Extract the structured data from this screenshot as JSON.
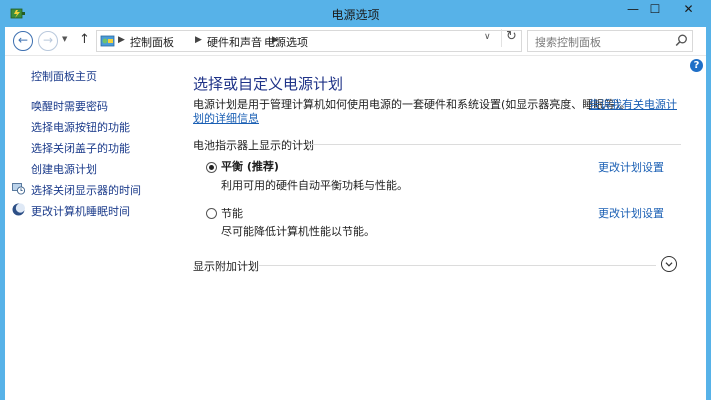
{
  "window": {
    "title": "电源选项",
    "minimize": "—",
    "maximize": "☐",
    "close": "✕"
  },
  "nav": {
    "back": "←",
    "forward": "→",
    "recent": "▼",
    "up": "↑",
    "breadcrumbs": [
      "控制面板",
      "硬件和声音",
      "电源选项"
    ],
    "separator": "▶",
    "dropdown": "∨",
    "refresh": "↻",
    "search_placeholder": "搜索控制面板"
  },
  "sidebar": {
    "home": "控制面板主页",
    "items": [
      {
        "label": "唤醒时需要密码"
      },
      {
        "label": "选择电源按钮的功能"
      },
      {
        "label": "选择关闭盖子的功能"
      },
      {
        "label": "创建电源计划"
      },
      {
        "label": "选择关闭显示器的时间",
        "icon": "monitor-clock-icon"
      },
      {
        "label": "更改计算机睡眠时间",
        "icon": "moon-icon"
      }
    ]
  },
  "help": "?",
  "main": {
    "title": "选择或自定义电源计划",
    "description": "电源计划是用于管理计算机如何使用电源的一套硬件和系统设置(如显示器亮度、睡眠等)。",
    "link_part1": "告诉我有关电源计",
    "link_part2": "划的详细信息",
    "section_label": "电池指示器上显示的计划",
    "plans": [
      {
        "name": "平衡 (推荐)",
        "desc": "利用可用的硬件自动平衡功耗与性能。",
        "link": "更改计划设置",
        "checked": true
      },
      {
        "name": "节能",
        "desc": "尽可能降低计算机性能以节能。",
        "link": "更改计划设置",
        "checked": false
      }
    ],
    "extra_label": "显示附加计划"
  },
  "colors": {
    "titlebar": "#57b2e8",
    "link": "#1a5fb4",
    "heading": "#1e3287"
  }
}
